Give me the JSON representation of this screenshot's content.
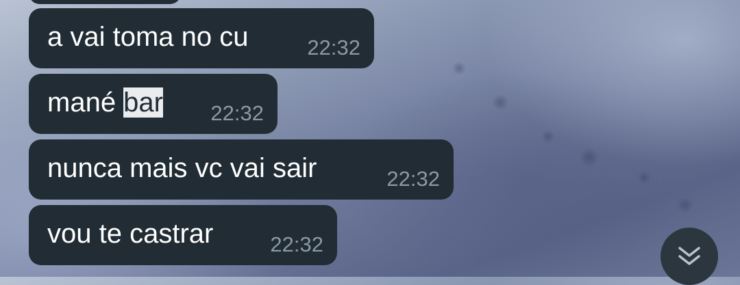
{
  "chat": {
    "messages": [
      {
        "text": "a vai toma no cu",
        "time": "22:32"
      },
      {
        "text_before": "mané ",
        "text_selected": "bar",
        "time": "22:32"
      },
      {
        "text": "nunca mais vc vai sair",
        "time": "22:32"
      },
      {
        "text": "vou te castrar",
        "time": "22:32"
      }
    ]
  },
  "icons": {
    "scroll_down": "double-chevron-down-icon"
  },
  "colors": {
    "bubble_bg": "#212c34",
    "message_text": "#ffffff",
    "timestamp_text": "#8a9aa6",
    "selection_highlight": "#e9edf0"
  }
}
